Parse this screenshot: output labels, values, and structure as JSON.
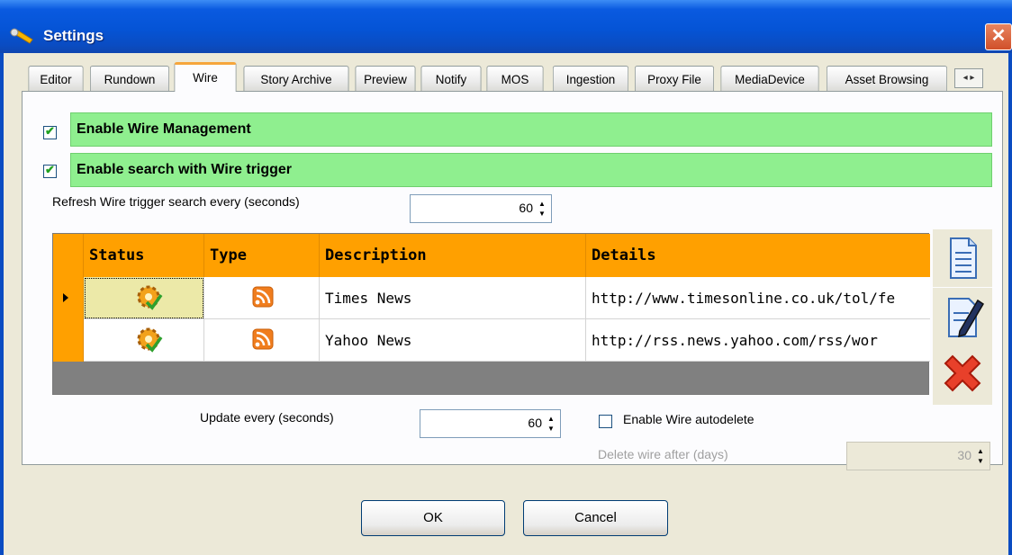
{
  "window": {
    "title": "Settings",
    "close": "✕"
  },
  "tabs": [
    "Editor",
    "Rundown",
    "Wire",
    "Story Archive",
    "Preview",
    "Notify",
    "MOS",
    "Ingestion",
    "Proxy File",
    "MediaDevice",
    "Asset Browsing"
  ],
  "tab_scroller": "◂ ▸",
  "wire": {
    "enable_management": {
      "label": "Enable Wire Management",
      "checked": true
    },
    "enable_search": {
      "label": "Enable search with Wire trigger",
      "checked": true
    },
    "refresh_label": "Refresh Wire trigger search every (seconds)",
    "refresh_value": "60",
    "grid": {
      "headers": [
        "Status",
        "Type",
        "Description",
        "Details"
      ],
      "rows": [
        {
          "description": "Times News",
          "details": "http://www.timesonline.co.uk/tol/fe"
        },
        {
          "description": "Yahoo News",
          "details": "http://rss.news.yahoo.com/rss/wor"
        }
      ]
    },
    "update_label": "Update every (seconds)",
    "update_value": "60",
    "autodelete_label": "Enable Wire autodelete",
    "delete_after_label": "Delete wire after (days)",
    "delete_after_value": "30"
  },
  "buttons": {
    "ok": "OK",
    "cancel": "Cancel"
  },
  "colors": {
    "accent": "#ffa000",
    "green_bar": "#8fef8f",
    "titlebar": "#0554d6"
  }
}
